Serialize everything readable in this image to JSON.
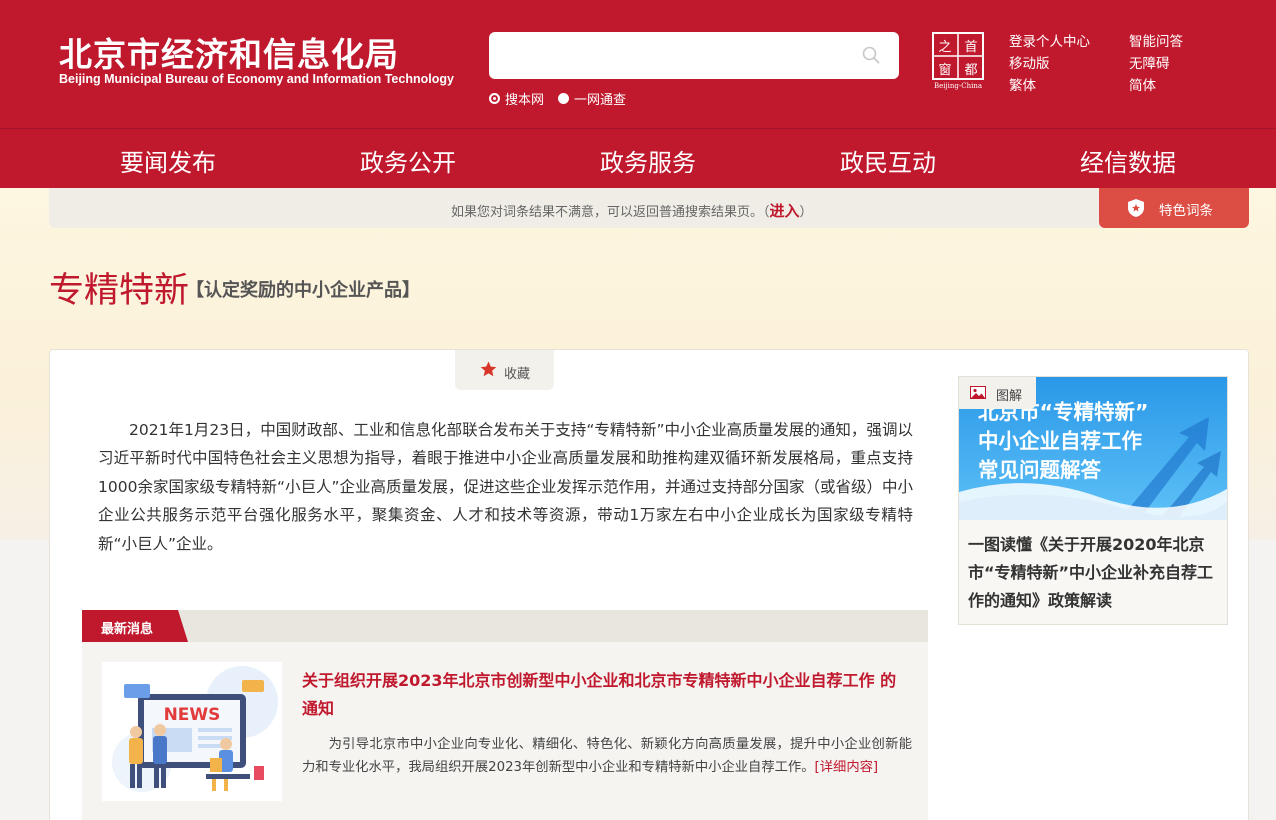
{
  "header": {
    "logo_cn": "北京市经济和信息化局",
    "logo_en": "Beijing Municipal Bureau of Economy and Information Technology",
    "search_placeholder": "",
    "search_scopes": [
      "搜本网",
      "一网通查"
    ],
    "capital_logo_chars": [
      "之",
      "首",
      "窗",
      "都"
    ],
    "capital_logo_caption": "Beijing-China",
    "links": [
      "登录个人中心",
      "智能问答",
      "移动版",
      "无障碍",
      "繁体",
      "简体"
    ]
  },
  "nav": [
    "要闻发布",
    "政务公开",
    "政务服务",
    "政民互动",
    "经信数据"
  ],
  "tip": {
    "text_before": "如果您对词条结果不满意，可以返回普通搜索结果页。（",
    "link": "进入",
    "text_after": "）"
  },
  "feature_button": "特色词条",
  "page": {
    "title": "专精特新",
    "subtitle": "【认定奖励的中小企业产品】",
    "collect": "收藏",
    "intro": "2021年1月23日，中国财政部、工业和信息化部联合发布关于支持“专精特新”中小企业高质量发展的通知，强调以习近平新时代中国特色社会主义思想为指导，着眼于推进中小企业高质量发展和助推构建双循环新发展格局，重点支持1000余家国家级专精特新“小巨人”企业高质量发展，促进这些企业发挥示范作用，并通过支持部分国家（或省级）中小企业公共服务示范平台强化服务水平，聚集资金、人才和技术等资源，带动1万家左右中小企业成长为国家级专精特新“小巨人”企业。"
  },
  "news": {
    "tag": "最新消息",
    "image_text": "NEWS",
    "title": "关于组织开展2023年北京市创新型中小企业和北京市专精特新中小企业自荐工作 的通知",
    "body": "为引导北京市中小企业向专业化、精细化、特色化、新颖化方向高质量发展，提升中小企业创新能力和专业化水平，我局组织开展2023年创新型中小企业和专精特新中小企业自荐工作。",
    "more": "[详细内容]"
  },
  "sidebar": {
    "tag": "图解",
    "image_lines": [
      "北京市“专精特新”",
      "中小企业自荐工作",
      "常见问题解答"
    ],
    "title": "一图读懂《关于开展2020年北京市“专精特新”中小企业补充自荐工作的通知》政策解读"
  },
  "colors": {
    "brand_red": "#c0192e",
    "feature_red": "#dc4d44",
    "sky_blue": "#2a98e8"
  }
}
